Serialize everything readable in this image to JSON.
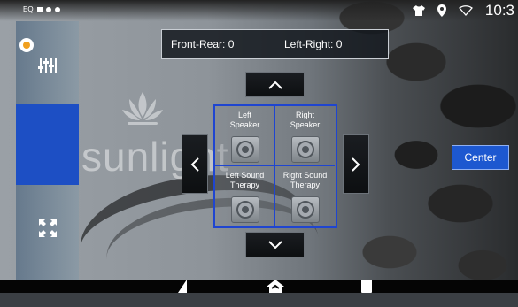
{
  "status_bar": {
    "indicator_label": "EQ",
    "time": "10:3",
    "icons": [
      "tshirt-icon",
      "location-pin-icon",
      "wifi-icon"
    ]
  },
  "sidebar": {
    "items": [
      {
        "name": "equalizer",
        "icon": "equalizer-sliders-icon",
        "active": false
      },
      {
        "name": "balance-fade",
        "icon": "balance-fade-icon",
        "active": true
      }
    ]
  },
  "background": {
    "watermark_text": "sunlight"
  },
  "readout": {
    "front_rear_label": "Front-Rear:",
    "front_rear_value": "0",
    "left_right_label": "Left-Right:",
    "left_right_value": "0"
  },
  "speaker_grid": {
    "cells": [
      {
        "label": "Left\nSpeaker"
      },
      {
        "label": "Right\nSpeaker"
      },
      {
        "label": "Left Sound\nTherapy"
      },
      {
        "label": "Right Sound\nTherapy"
      }
    ]
  },
  "center_button": {
    "label": "Center"
  },
  "colors": {
    "accent": "#1d58d0",
    "sidebar_active": "#1d4fc4",
    "grid_border": "#1f45d0"
  }
}
